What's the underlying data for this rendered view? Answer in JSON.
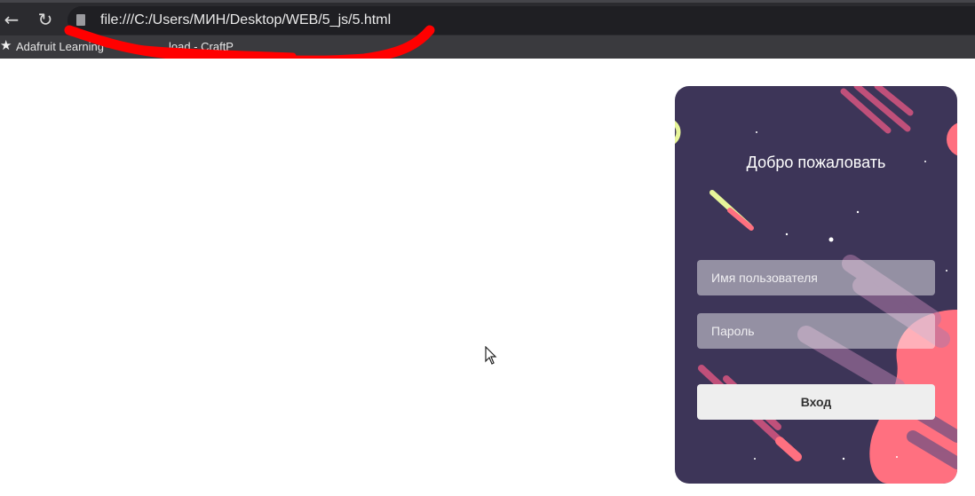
{
  "browser": {
    "url": "file:///C:/Users/МИН/Desktop/WEB/5_js/5.html",
    "bookmarks": [
      {
        "label": "Adafruit Learning"
      },
      {
        "label": "load - CraftP"
      }
    ]
  },
  "login_card": {
    "title": "Добро пожаловать",
    "username_placeholder": "Имя пользователя",
    "username_value": "",
    "password_placeholder": "Пароль",
    "password_value": "",
    "submit_label": "Вход"
  },
  "colors": {
    "card_background": "#3d3558",
    "planet_coral": "#ff7080",
    "planet_ring": "#e7f59a",
    "redaction_mark": "#ff0000"
  }
}
